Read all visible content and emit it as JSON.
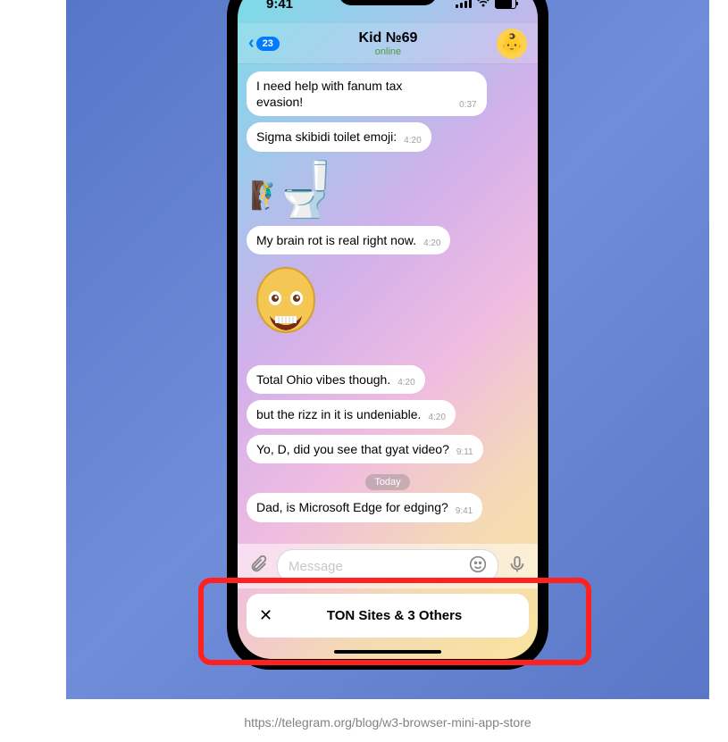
{
  "status_bar": {
    "time": "9:41"
  },
  "header": {
    "back_count": "23",
    "contact_name": "Kid №69",
    "status": "online",
    "avatar_emoji": "👶"
  },
  "messages": [
    {
      "text": "I need help with fanum tax evasion!",
      "time": "0:37",
      "type": "text"
    },
    {
      "text": "Sigma skibidi toilet emoji:",
      "time": "4:20",
      "type": "text"
    },
    {
      "type": "toilet_sticker"
    },
    {
      "text": "My brain rot is real right now.",
      "time": "4:20",
      "type": "text"
    },
    {
      "type": "bald_sticker"
    },
    {
      "text": "Total Ohio vibes though.",
      "time": "4:20",
      "type": "text"
    },
    {
      "text": "but the rizz in it is undeniable.",
      "time": "4:20",
      "type": "text"
    },
    {
      "text": "Yo, D, did you see that gyat video?",
      "time": "9:11",
      "type": "text"
    },
    {
      "type": "date",
      "label": "Today"
    },
    {
      "text": "Dad, is Microsoft Edge for edging?",
      "time": "9:41",
      "type": "text"
    }
  ],
  "input": {
    "placeholder": "Message"
  },
  "mini_app_bar": {
    "title": "TON Sites & 3 Others"
  },
  "caption": "https://telegram.org/blog/w3-browser-mini-app-store"
}
